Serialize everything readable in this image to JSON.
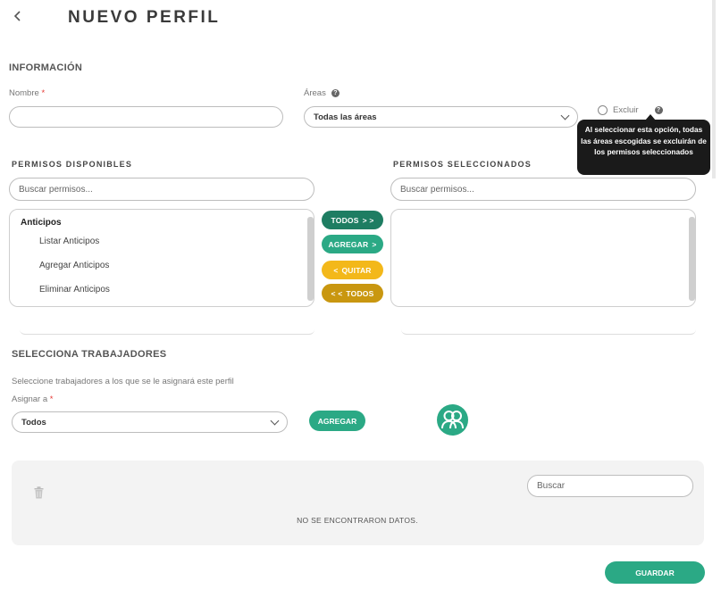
{
  "header": {
    "back_icon": "chevron-left-icon",
    "title": "NUEVO PERFIL"
  },
  "informacion": {
    "section_title": "INFORMACIÓN",
    "nombre_label": "Nombre",
    "nombre_required": "*",
    "nombre_value": "",
    "areas_label": "Áreas",
    "areas_help_icon": "help-icon",
    "areas_value": "Todas las áreas",
    "excluir_label": "Excluir",
    "excluir_checked": false,
    "tooltip": "Al seleccionar esta opción, todas las áreas escogidas se excluirán de los permisos seleccionados"
  },
  "permisos": {
    "disponibles_title": "PERMISOS DISPONIBLES",
    "seleccionados_title": "PERMISOS SELECCIONADOS",
    "search_placeholder_left": "Buscar permisos...",
    "search_placeholder_right": "Buscar permisos...",
    "groups": [
      {
        "name": "Anticipos",
        "items": [
          "Listar Anticipos",
          "Agregar Anticipos",
          "Eliminar Anticipos"
        ]
      }
    ],
    "selected": [],
    "buttons": {
      "todos_add": "TODOS",
      "agregar": "AGREGAR",
      "quitar": "QUITAR",
      "todos_remove": "TODOS"
    }
  },
  "trabajadores": {
    "section_title": "SELECCIONA TRABAJADORES",
    "description": "Seleccione trabajadores a los que se le asignará este perfil",
    "asignar_label": "Asignar a",
    "asignar_required": "*",
    "asignar_value": "Todos",
    "agregar_button": "AGREGAR",
    "group_icon": "users-group-icon"
  },
  "tabla": {
    "trash_icon": "trash-icon",
    "search_placeholder": "Buscar",
    "empty_message": "NO SE ENCONTRARON DATOS."
  },
  "footer": {
    "save_button": "GUARDAR"
  },
  "colors": {
    "green": "#2ba985",
    "dark_green": "#1e7d62",
    "yellow": "#f3b81a",
    "gold": "#c99710",
    "tooltip_bg": "#1a1a1a"
  }
}
